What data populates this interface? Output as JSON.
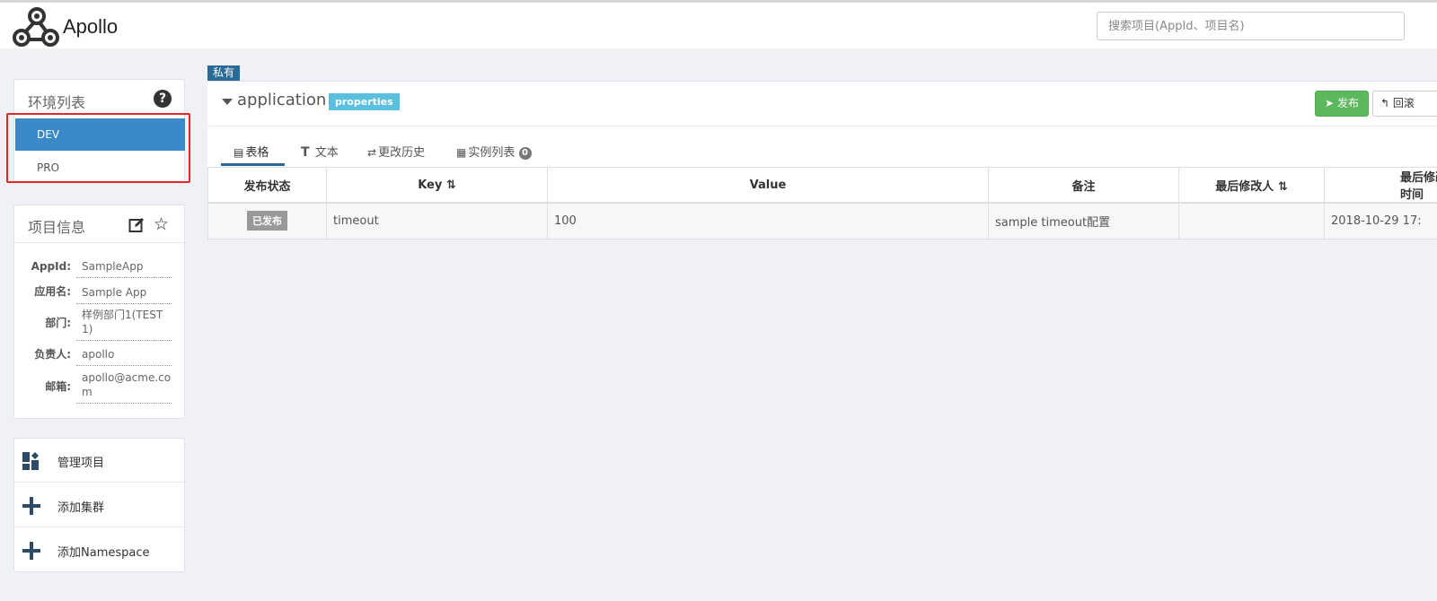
{
  "header": {
    "brand": "Apollo",
    "search_placeholder": "搜索项目(AppId、项目名)"
  },
  "env_panel": {
    "title": "环境列表",
    "help": "?",
    "items": [
      {
        "label": "DEV",
        "selected": true
      },
      {
        "label": "PRO",
        "selected": false
      }
    ]
  },
  "info_panel": {
    "title": "项目信息",
    "rows": [
      {
        "label": "AppId:",
        "value": "SampleApp"
      },
      {
        "label": "应用名:",
        "value": "Sample App"
      },
      {
        "label": "部门:",
        "value": "样例部门1(TEST1)"
      },
      {
        "label": "负责人:",
        "value": "apollo"
      },
      {
        "label": "邮箱:",
        "value": "apollo@acme.com"
      }
    ]
  },
  "actions": [
    {
      "label": "管理项目",
      "icon": "dashboard-icon"
    },
    {
      "label": "添加集群",
      "icon": "plus-icon"
    },
    {
      "label": "添加Namespace",
      "icon": "plus-icon"
    }
  ],
  "namespace": {
    "private_tag": "私有",
    "name": "application",
    "format": "properties",
    "publish_label": "发布",
    "rollback_label": "回滚",
    "tabs": [
      {
        "label": "表格",
        "icon": "table-icon",
        "active": true
      },
      {
        "label": "文本",
        "icon": "text-icon",
        "active": false
      },
      {
        "label": "更改历史",
        "icon": "history-icon",
        "active": false
      },
      {
        "label": "实例列表",
        "icon": "instance-icon",
        "active": false,
        "badge": "0"
      }
    ],
    "table": {
      "headers": [
        "发布状态",
        "Key",
        "Value",
        "备注",
        "最后修改人",
        "最后修改时间"
      ],
      "rows": [
        {
          "status": "已发布",
          "key": "timeout",
          "value": "100",
          "comment": "sample timeout配置",
          "modifier": "",
          "modified_time": "2018-10-29 17:"
        }
      ]
    }
  },
  "colors": {
    "env_selected": "#3b89c9",
    "publish_button": "#5cb85c",
    "format_tag": "#5bc0de",
    "private_tag": "#296a96",
    "highlight_box": "#e02828"
  }
}
